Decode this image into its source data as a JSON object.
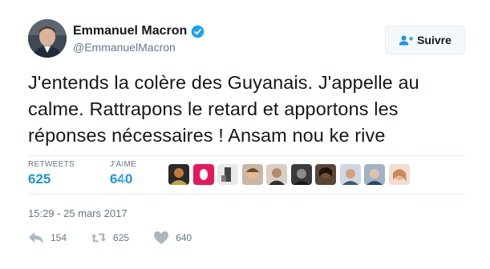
{
  "user": {
    "name": "Emmanuel Macron",
    "handle": "@EmmanuelMacron",
    "verified_icon": "verified-badge-icon"
  },
  "follow_button": {
    "label": "Suivre",
    "icon": "add-user-icon"
  },
  "tweet": {
    "text": "J'entends la colère des Guyanais. J'appelle au calme. Rattrapons le retard et apportons les réponses nécessaires ! Ansam nou ke rive",
    "timestamp": "15:29 - 25 mars 2017"
  },
  "stats": {
    "retweets_label": "RETWEETS",
    "retweets_value": "625",
    "likes_label": "J'AIME",
    "likes_value": "640"
  },
  "liker_avatars": [
    "liker-avatar",
    "liker-avatar",
    "liker-avatar",
    "liker-avatar",
    "liker-avatar",
    "liker-avatar",
    "liker-avatar",
    "liker-avatar",
    "liker-avatar",
    "liker-avatar"
  ],
  "actions": {
    "reply": {
      "icon": "reply-icon",
      "count": "154"
    },
    "retweet": {
      "icon": "retweet-icon",
      "count": "625"
    },
    "like": {
      "icon": "heart-icon",
      "count": "640"
    }
  },
  "colors": {
    "accent": "#1b95e0",
    "text": "#14171a",
    "muted": "#657786",
    "icon": "#aab8c2"
  }
}
